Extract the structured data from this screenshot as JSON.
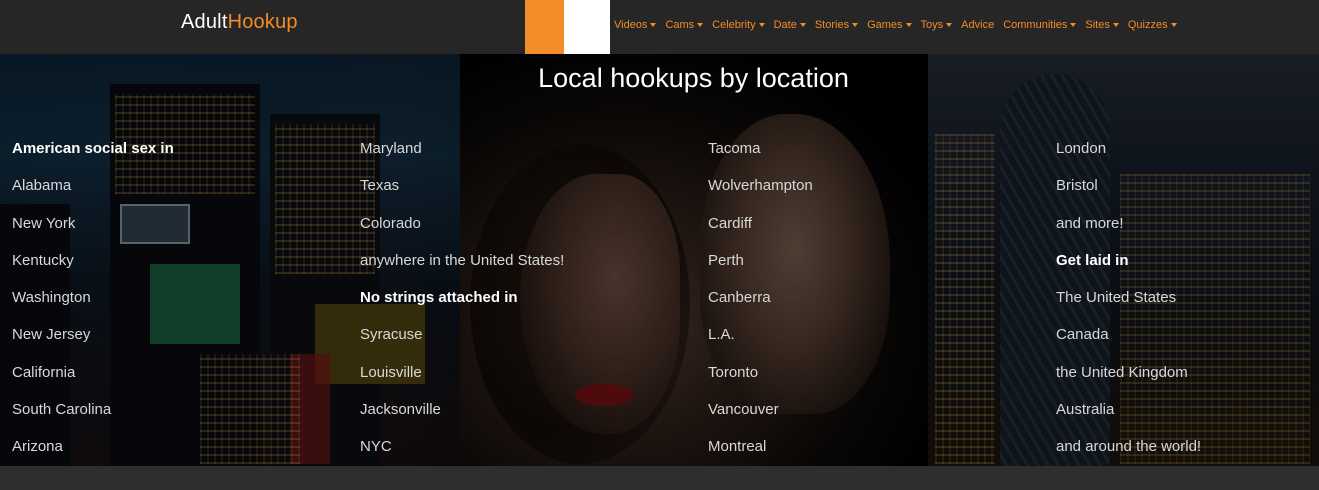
{
  "header": {
    "logo_part1": "Adult",
    "logo_part2": "Hookup",
    "nav": [
      {
        "label": "Videos",
        "dropdown": true
      },
      {
        "label": "Cams",
        "dropdown": true
      },
      {
        "label": "Celebrity",
        "dropdown": true
      },
      {
        "label": "Date",
        "dropdown": true
      },
      {
        "label": "Stories",
        "dropdown": true
      },
      {
        "label": "Games",
        "dropdown": true
      },
      {
        "label": "Toys",
        "dropdown": true
      },
      {
        "label": "Advice",
        "dropdown": false
      },
      {
        "label": "Communities",
        "dropdown": true
      },
      {
        "label": "Sites",
        "dropdown": true
      },
      {
        "label": "Quizzes",
        "dropdown": true
      }
    ]
  },
  "hero": {
    "title": "Local hookups by location",
    "columns": [
      [
        "American social sex in",
        "Alabama",
        "New York",
        "Kentucky",
        "Washington",
        "New Jersey",
        "California",
        "South Carolina",
        "Arizona"
      ],
      [
        "Maryland",
        "Texas",
        "Colorado",
        "anywhere in the United States!",
        "No strings attached in",
        "Syracuse",
        "Louisville",
        "Jacksonville",
        "NYC"
      ],
      [
        "Tacoma",
        "Wolverhampton",
        "Cardiff",
        "Perth",
        "Canberra",
        "L.A.",
        "Toronto",
        "Vancouver",
        "Montreal"
      ],
      [
        "London",
        "Bristol",
        "and more!",
        "Get laid in",
        "The United States",
        "Canada",
        "the United Kingdom",
        "Australia",
        "and around the world!"
      ]
    ],
    "headings": [
      "American social sex in",
      "No strings attached in",
      "Get laid in"
    ]
  },
  "colors": {
    "accent": "#f28c28",
    "header_bg": "#262626",
    "text": "#d8d8d8"
  }
}
